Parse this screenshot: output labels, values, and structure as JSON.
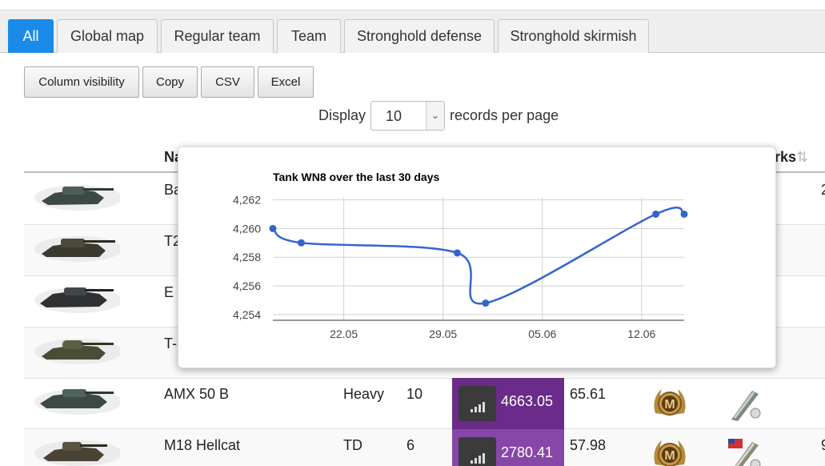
{
  "tabs": [
    {
      "label": "All",
      "active": true
    },
    {
      "label": "Global map"
    },
    {
      "label": "Regular team"
    },
    {
      "label": "Team"
    },
    {
      "label": "Stronghold defense"
    },
    {
      "label": "Stronghold skirmish"
    }
  ],
  "buttons": {
    "column_visibility": "Column visibility",
    "copy": "Copy",
    "csv": "CSV",
    "excel": "Excel"
  },
  "display": {
    "prefix": "Display",
    "value": "10",
    "suffix": "records per page"
  },
  "headers": {
    "name": "Na",
    "marks": "rks"
  },
  "rows": [
    {
      "name": "Ba",
      "class": "",
      "tier": "",
      "wn8": "",
      "winrate": ""
    },
    {
      "name": "T2",
      "class": "",
      "tier": "",
      "wn8": "",
      "winrate": ""
    },
    {
      "name": "E",
      "class": "",
      "tier": "",
      "wn8": "",
      "winrate": ""
    },
    {
      "name": "T-",
      "class": "",
      "tier": "",
      "wn8": "",
      "winrate": ""
    },
    {
      "name": "AMX 50 B",
      "class": "Heavy",
      "tier": "10",
      "wn8": "4663.05",
      "winrate": "65.61"
    },
    {
      "name": "M18 Hellcat",
      "class": "TD",
      "tier": "6",
      "wn8": "2780.41",
      "winrate": "57.98"
    }
  ],
  "row_side_values": [
    "2",
    "9"
  ],
  "colors": {
    "tab_active": "#1a8be8",
    "wn8_dark": "#6a2b8a",
    "wn8_light": "#8747a8",
    "line": "#3366cc"
  },
  "chart_data": {
    "type": "line",
    "title": "Tank WN8 over the last 30 days",
    "xlabel": "",
    "ylabel": "",
    "x_ticks": [
      "22.05",
      "29.05",
      "05.06",
      "12.06"
    ],
    "y_ticks": [
      "4,254",
      "4,256",
      "4,258",
      "4,260",
      "4,262"
    ],
    "ylim": [
      4253.6,
      4262.2
    ],
    "xlim": [
      "2019-05-17",
      "2019-06-15"
    ],
    "grid": true,
    "series": [
      {
        "points": [
          {
            "x": "2019-05-17",
            "y": 4260.0
          },
          {
            "x": "2019-05-19",
            "y": 4259.0
          },
          {
            "x": "2019-05-30",
            "y": 4258.3
          },
          {
            "x": "2019-06-01",
            "y": 4254.8
          },
          {
            "x": "2019-06-13",
            "y": 4261.0
          },
          {
            "x": "2019-06-15",
            "y": 4261.0
          }
        ]
      }
    ]
  }
}
